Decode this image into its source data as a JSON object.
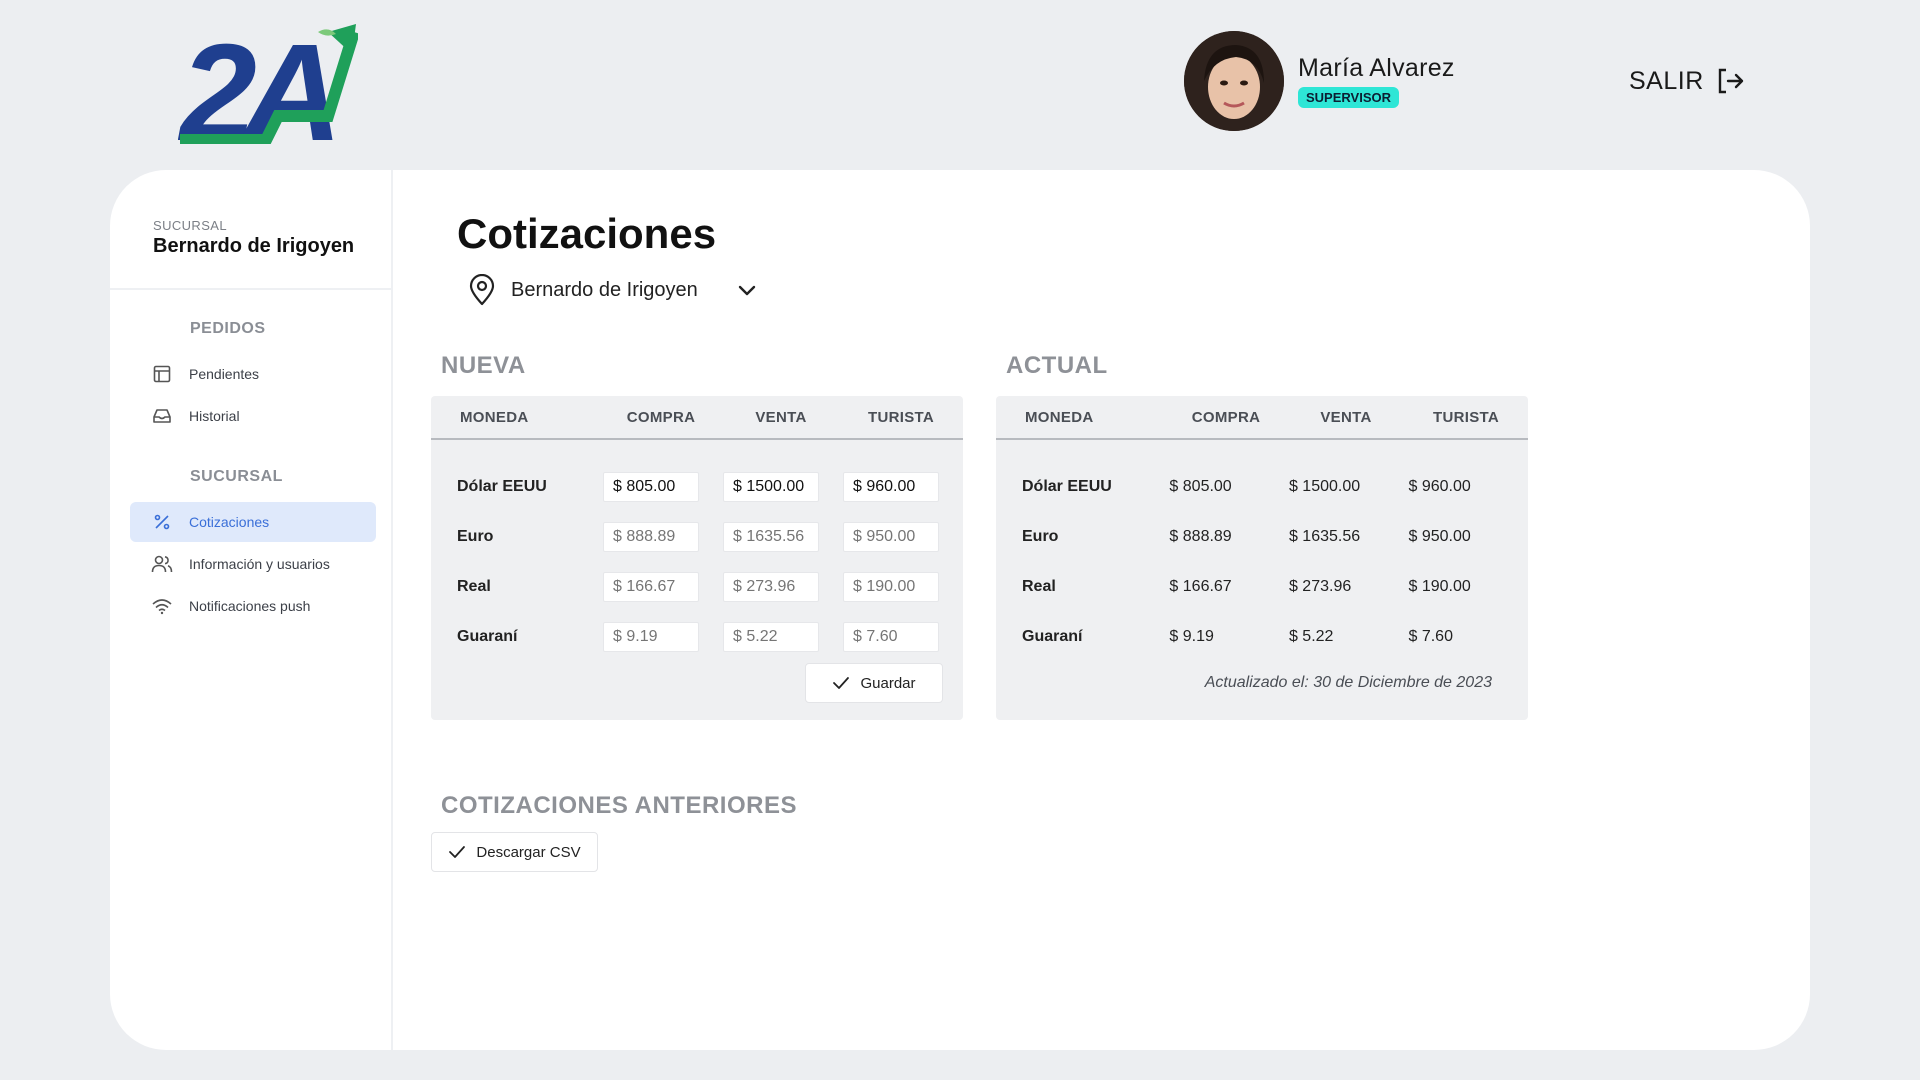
{
  "brand": {
    "logo_text": "2A",
    "primary_color": "#1f3f8f",
    "accent_color": "#1fa05a"
  },
  "user": {
    "name": "María Alvarez",
    "role": "SUPERVISOR"
  },
  "header": {
    "logout_label": "SALIR"
  },
  "sidebar": {
    "branch_caption": "SUCURSAL",
    "branch_name": "Bernardo de Irigoyen",
    "sections": [
      {
        "title": "PEDIDOS",
        "items": [
          {
            "label": "Pendientes",
            "icon": "layout-icon",
            "active": false
          },
          {
            "label": "Historial",
            "icon": "inbox-icon",
            "active": false
          }
        ]
      },
      {
        "title": "SUCURSAL",
        "items": [
          {
            "label": "Cotizaciones",
            "icon": "percent-icon",
            "active": true
          },
          {
            "label": "Información y usuarios",
            "icon": "users-icon",
            "active": false
          },
          {
            "label": "Notificaciones push",
            "icon": "wifi-icon",
            "active": false
          }
        ]
      }
    ]
  },
  "main": {
    "title": "Cotizaciones",
    "branch_select": {
      "value": "Bernardo de Irigoyen"
    },
    "columns": [
      "MONEDA",
      "COMPRA",
      "VENTA",
      "TURISTA"
    ],
    "nueva": {
      "title": "NUEVA",
      "rows": [
        {
          "currency": "Dólar EEUU",
          "compra": "$ 805.00",
          "venta": "$ 1500.00",
          "turista": "$ 960.00",
          "filled": true
        },
        {
          "currency": "Euro",
          "compra": "$ 888.89",
          "venta": "$ 1635.56",
          "turista": "$ 950.00",
          "filled": false
        },
        {
          "currency": "Real",
          "compra": "$ 166.67",
          "venta": "$ 273.96",
          "turista": "$ 190.00",
          "filled": false
        },
        {
          "currency": "Guaraní",
          "compra": "$ 9.19",
          "venta": "$ 5.22",
          "turista": "$ 7.60",
          "filled": false
        }
      ],
      "save_label": "Guardar"
    },
    "actual": {
      "title": "ACTUAL",
      "rows": [
        {
          "currency": "Dólar EEUU",
          "compra": "$ 805.00",
          "venta": "$ 1500.00",
          "turista": "$ 960.00"
        },
        {
          "currency": "Euro",
          "compra": "$ 888.89",
          "venta": "$ 1635.56",
          "turista": "$ 950.00"
        },
        {
          "currency": "Real",
          "compra": "$ 166.67",
          "venta": "$ 273.96",
          "turista": "$ 190.00"
        },
        {
          "currency": "Guaraní",
          "compra": "$ 9.19",
          "venta": "$ 5.22",
          "turista": "$ 7.60"
        }
      ],
      "updated": "Actualizado el: 30 de Diciembre de 2023"
    },
    "history": {
      "title": "COTIZACIONES ANTERIORES",
      "csv_label": "Descargar CSV"
    }
  }
}
